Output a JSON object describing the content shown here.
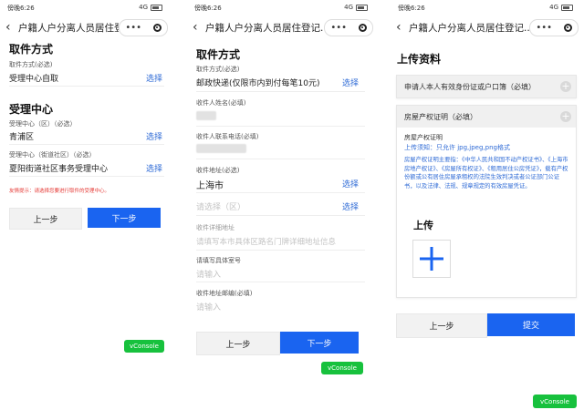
{
  "status": {
    "carrier": "傍晚6:26",
    "signal": "4G"
  },
  "nav": {
    "title": "户籍人户分离人员居住登记...",
    "back": "‹",
    "more": "•••"
  },
  "screen1": {
    "section1": "取件方式",
    "method_label": "取件方式(必选)",
    "method_value": "受理中心自取",
    "select": "选择",
    "section2": "受理中心",
    "district_label": "受理中心（区）（必选）",
    "district_value": "青浦区",
    "street_label": "受理中心（街道社区）（必选）",
    "street_value": "夏阳街道社区事务受理中心",
    "tip": "友情提示：请选择您要进行取件的受理中心。",
    "prev": "上一步",
    "next": "下一步",
    "vconsole": "vConsole"
  },
  "screen2": {
    "section": "取件方式",
    "method_label": "取件方式(必选)",
    "method_value": "邮政快递(仅限市内到付每笔10元)",
    "select": "选择",
    "name_label": "收件人姓名(必填)",
    "phone_label": "收件人联系电话(必填)",
    "address_label": "收件地址(必选)",
    "city_value": "上海市",
    "district_placeholder": "请选择（区）",
    "detail_label": "收件详细地址",
    "detail_placeholder": "请填写本市具体区路名门牌详细地址信息",
    "room_label": "请填写具体室号",
    "room_placeholder": "请输入",
    "zip_label": "收件地址邮编(必填)",
    "zip_placeholder": "请输入",
    "prev": "上一步",
    "next": "下一步",
    "vconsole": "vConsole"
  },
  "screen3": {
    "title": "上传资料",
    "card1_title": "申请人本人有效身份证或户口簿（必填）",
    "card2_title": "房屋产权证明（必填）",
    "doc_name": "房屋产权证明",
    "upload_note": "上传须知：只允许 jpg,jpeg,png格式",
    "desc": "房屋产权证明主要指：《中华人民共和国不动产权证书》、《上海市房地产权证》、《房屋所有权证》、《租用居住公房凭证》，载有产权份额或公有居住房屋承租权的法院生效判决或者公证部门公证书，以及法律、法规、规章规定的有效房屋凭证。",
    "upload": "上传",
    "prev": "上一步",
    "submit": "提交",
    "vconsole": "vConsole"
  },
  "colors": {
    "primary": "#1a64f0",
    "link": "#2f6bd6",
    "warning": "#e53935",
    "vconsole": "#17c13d"
  }
}
